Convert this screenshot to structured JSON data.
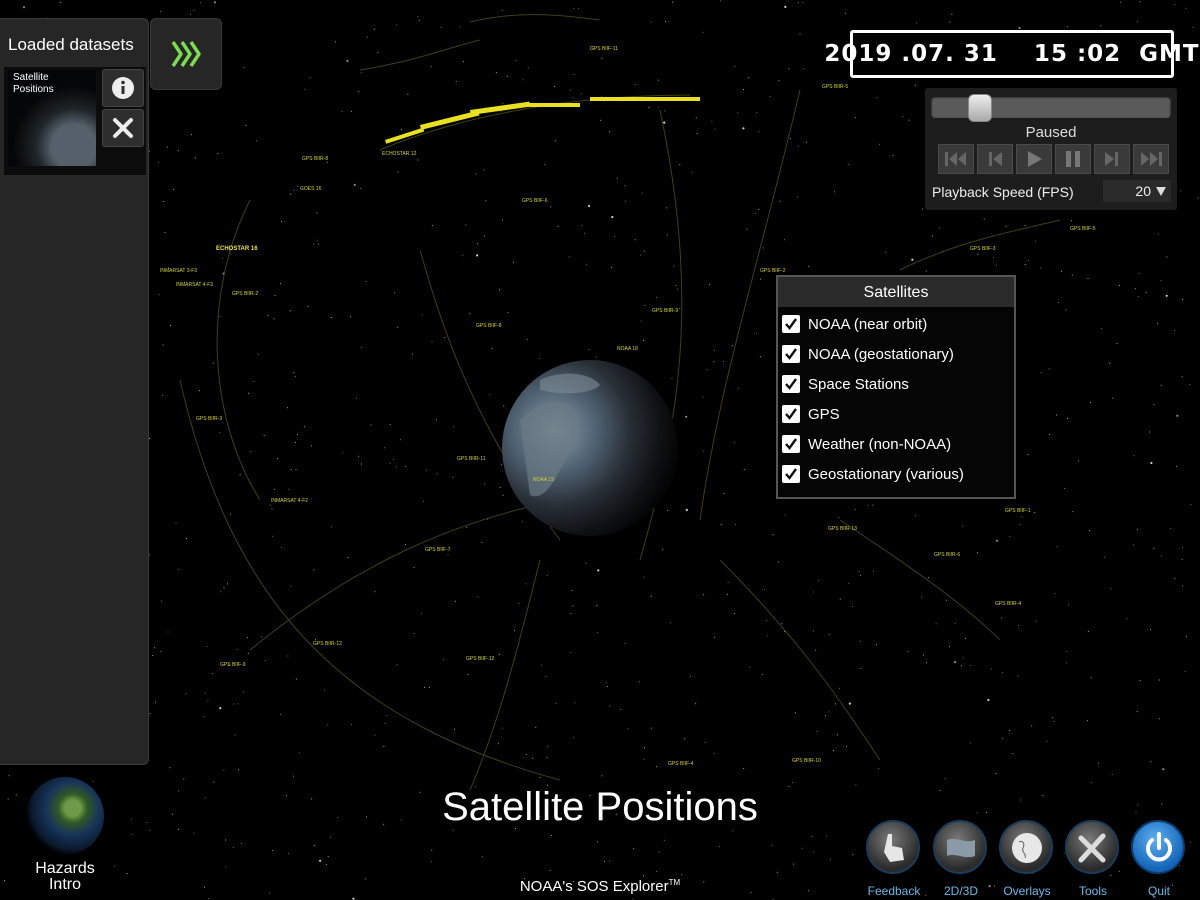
{
  "left_panel": {
    "title": "Loaded datasets",
    "dataset": {
      "name_line1": "Satellite",
      "name_line2": "Positions"
    },
    "info_icon": "info-icon",
    "remove_icon": "close-icon",
    "expand_icon": "chevron-right-icon"
  },
  "datetime": "2019 .07. 31    15 :02  GMT",
  "playback": {
    "status": "Paused",
    "fps_label": "Playback Speed (FPS)",
    "fps_value": "20",
    "timeline_position": 0.17,
    "controls": [
      "skip-to-start-icon",
      "step-back-icon",
      "play-icon",
      "pause-icon",
      "step-forward-icon",
      "skip-to-end-icon"
    ]
  },
  "satellites_panel": {
    "title": "Satellites",
    "items": [
      {
        "label": "NOAA (near orbit)",
        "checked": true
      },
      {
        "label": "NOAA (geostationary)",
        "checked": true
      },
      {
        "label": "Space Stations",
        "checked": true
      },
      {
        "label": "GPS",
        "checked": true
      },
      {
        "label": "Weather (non-NOAA)",
        "checked": true
      },
      {
        "label": "Geostationary (various)",
        "checked": true
      }
    ]
  },
  "scene": {
    "labels": [
      "ECHOSTAR 16",
      "GPS BIIF-1",
      "GPS BIIR-13",
      "GPS BIIF-3",
      "INMARSAT 3-F3",
      "INMARSAT 4-F3",
      "GPS BIIR-2",
      "GPS BIIF-7",
      "GPS BIIR-12",
      "GPS BIIR-4",
      "NOAA 19",
      "NOAA 18",
      "GPS BIIF-11",
      "GPS BIIR-8",
      "GPS BIIF-6",
      "GOES 16",
      "ECHOSTAR 12",
      "GPS BIIR-3",
      "GPS BIIF-12",
      "GPS BIIF-2",
      "GPS BIIR-9",
      "GPS BIIF-8",
      "GPS BIIR-11",
      "INMARSAT 4-F2",
      "GPS BIIF-5",
      "GPS BIIR-5",
      "GPS BIIR-6",
      "GPS BIIF-9",
      "GPS BIIF-4",
      "GPS BIIR-10"
    ]
  },
  "main_title": "Satellite Positions",
  "app_title": "NOAA's SOS Explorer",
  "app_title_tm": "TM",
  "hazards": {
    "line1": "Hazards",
    "line2": "Intro"
  },
  "toolbar": {
    "feedback": "Feedback",
    "view_2d3d": "2D/3D",
    "overlays": "Overlays",
    "tools": "Tools",
    "quit": "Quit"
  },
  "colors": {
    "satellite_label": "#d6d23a",
    "panel_bg": "#262626",
    "accent": "#6db8e8",
    "expand_chevron": "#7ddc4f"
  }
}
